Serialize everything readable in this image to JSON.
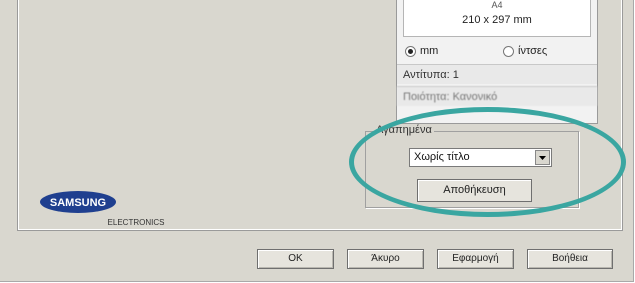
{
  "paper": {
    "name": "A4",
    "size": "210 x 297 mm"
  },
  "units": {
    "mm_label": "mm",
    "inches_label": "ίντσες",
    "selected": "mm"
  },
  "info": {
    "copies": "Αντίτυπα: 1",
    "quality": "Ποιότητα: Κανονικό"
  },
  "favorites": {
    "label": "Αγαπημένα",
    "selected_value": "Χωρίς τίτλο",
    "save_label": "Αποθήκευση"
  },
  "brand": {
    "name": "SAMSUNG",
    "sub": "ELECTRONICS"
  },
  "footer": {
    "ok_label": "OK",
    "cancel_label": "Άκυρο",
    "apply_label": "Εφαρμογή",
    "help_label": "Βοήθεια"
  },
  "colors": {
    "highlight_circle": "#3aa6a1",
    "dialog_bg": "#d9d7cf",
    "logo_blue": "#1f3f8f"
  }
}
